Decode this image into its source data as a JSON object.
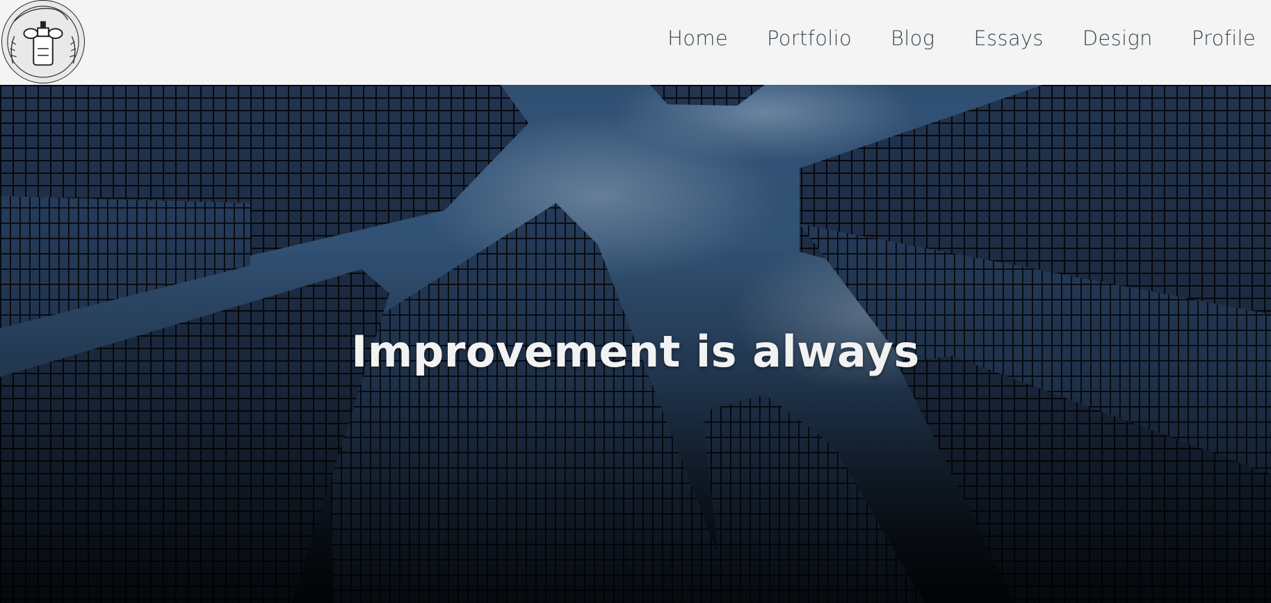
{
  "header": {
    "logo_icon": "emblem-logo-icon",
    "nav": [
      {
        "label": "Home"
      },
      {
        "label": "Portfolio"
      },
      {
        "label": "Blog"
      },
      {
        "label": "Essays"
      },
      {
        "label": "Design"
      },
      {
        "label": "Profile"
      }
    ]
  },
  "hero": {
    "title": "Improvement is always",
    "background": "skyscrapers-looking-up-photo",
    "colors": {
      "sky": "#3a5f87",
      "glass": "#1d2c44",
      "text": "#f2f2f2"
    }
  }
}
